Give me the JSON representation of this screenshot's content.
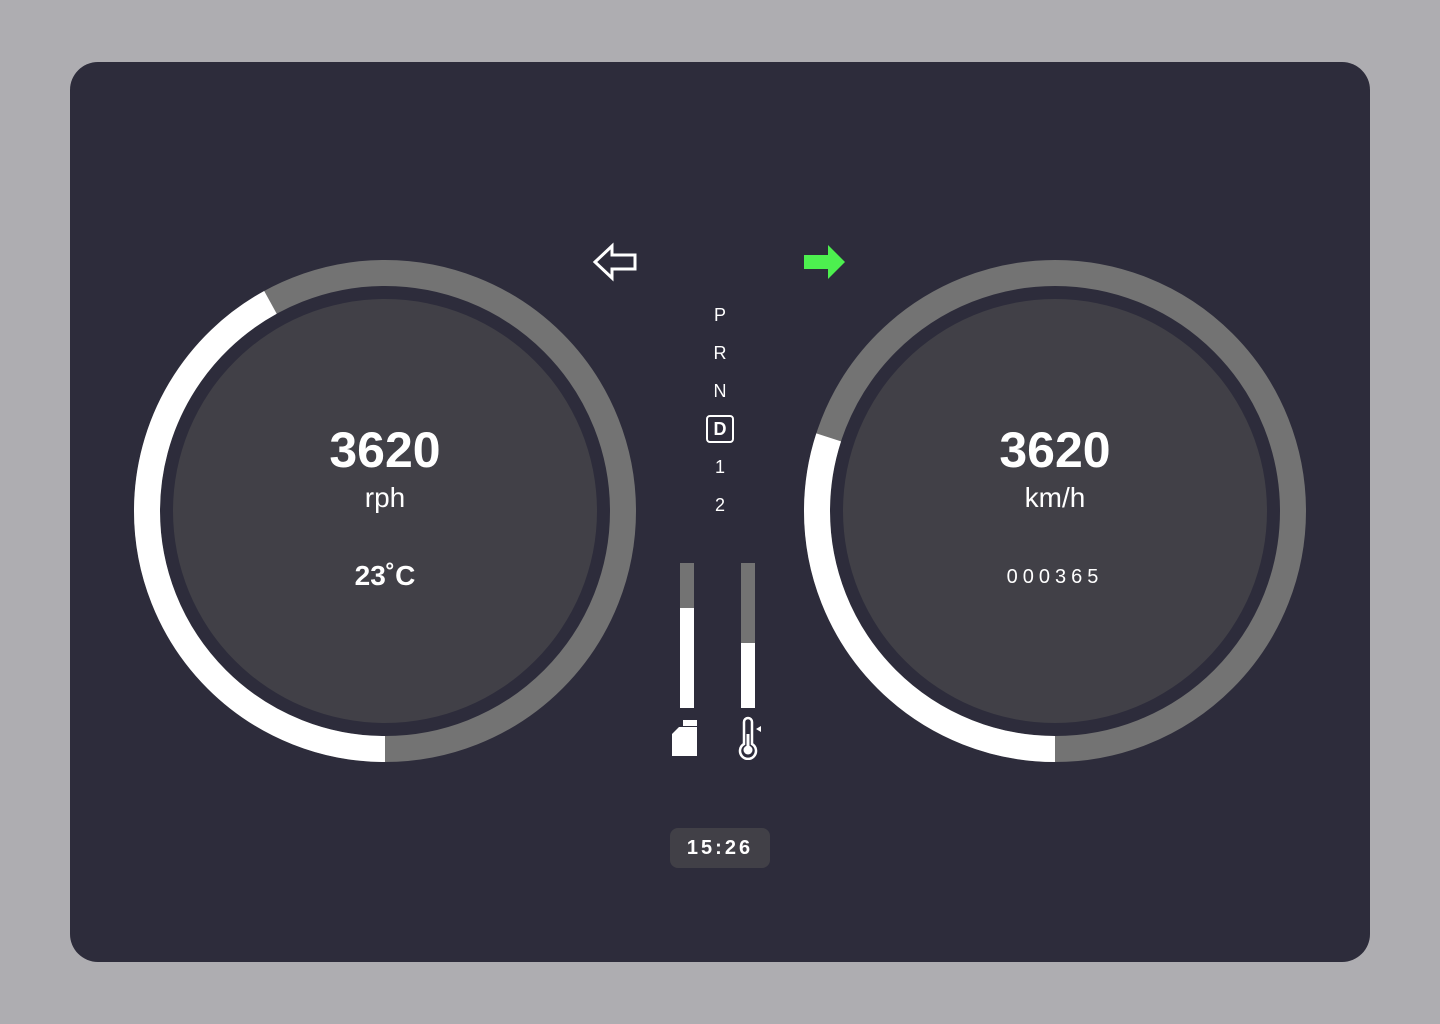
{
  "colors": {
    "background": "#aeadb1",
    "panel": "#2d2c3b",
    "gauge_face": "#414047",
    "gauge_track": "#737373",
    "gauge_progress": "#ffffff",
    "turn_signal_active": "#4df04f"
  },
  "turn_signals": {
    "left": {
      "icon": "arrow-left-outline-icon",
      "active": false
    },
    "right": {
      "icon": "arrow-right-filled-icon",
      "active": true
    }
  },
  "tachometer": {
    "value": "3620",
    "unit": "rph",
    "temperature": "23˚C",
    "fill_fraction": 0.42
  },
  "speedometer": {
    "value": "3620",
    "unit": "km/h",
    "odometer": "000365",
    "fill_fraction": 0.3
  },
  "gearbox": {
    "gears": [
      "P",
      "R",
      "N",
      "D",
      "1",
      "2"
    ],
    "selected": "D"
  },
  "levels": {
    "fuel": {
      "icon": "fuel-can-icon",
      "fraction": 0.69
    },
    "coolant_temperature": {
      "icon": "thermometer-icon",
      "fraction": 0.45
    }
  },
  "clock": {
    "time": "15:26"
  }
}
